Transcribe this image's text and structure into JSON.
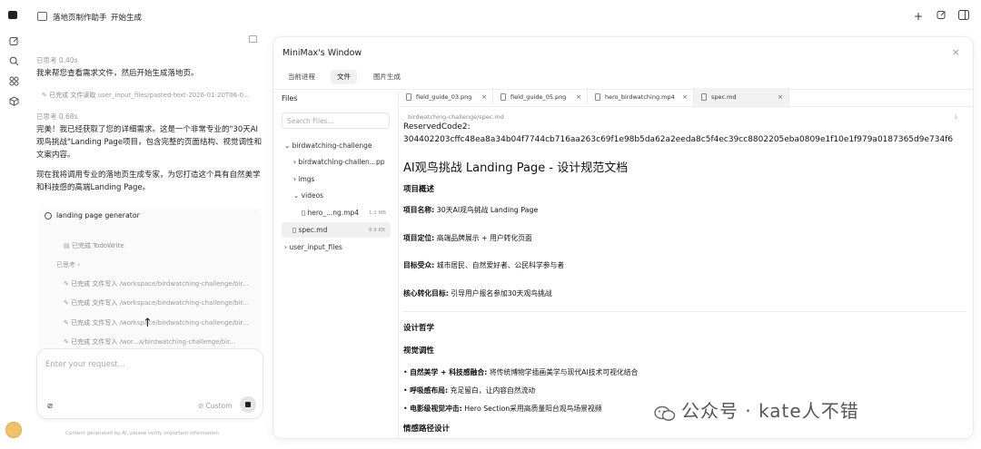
{
  "app": {
    "title": "落地页制作助手",
    "subtitle": "开始生成"
  },
  "rail": {
    "icons": [
      "logo-icon",
      "edit-icon",
      "search-icon",
      "grid-icon",
      "box-icon"
    ]
  },
  "chat": {
    "thought1": "已思考 0.40s",
    "msg1": "我来帮您查看需求文件，然后开始生成落地页。",
    "tool1_status": "已完成",
    "tool1_action": "文件读取",
    "tool1_path": "user_input_files/pasted-text-2026-01-20T06-0...",
    "thought2": "已思考 0.68s",
    "msg2": "完美！我已经获取了您的详细需求。这是一个非常专业的\"30天AI观鸟挑战\"Landing Page项目，包含完整的页面结构、视觉调性和文案内容。",
    "msg3": "现在我将调用专业的落地页生成专家，为您打造这个具有自然美学和科技感的高端Landing Page。",
    "generator_label": "landing page generator",
    "todo_status": "已完成",
    "todo_label": "TodoWrite",
    "thought3": "已思考",
    "file_writes": [
      {
        "status": "已完成",
        "action": "文件写入",
        "path": "/workspace/birdwatching-challenge/bir..."
      },
      {
        "status": "已完成",
        "action": "文件写入",
        "path": "/workspace/birdwatching-challenge/bir..."
      },
      {
        "status": "已完成",
        "action": "文件写入",
        "path": "/workspace/birdwatching-challenge/bir..."
      },
      {
        "status": "已完成",
        "action": "文件写入",
        "path": "/wor...a/birdwatching-challenge/bir..."
      },
      {
        "status": "已完成",
        "action": "文件写入",
        "path": "/workspace/birdwatching-challenge/bir..."
      }
    ],
    "input_placeholder": "Enter your request...",
    "custom_label": "Custom",
    "footer": "Content generated by AI, please verify important information"
  },
  "window": {
    "title": "MiniMax's Window",
    "tabs": [
      "当前进程",
      "文件",
      "图片生成"
    ],
    "active_tab": 1,
    "files_title": "Files",
    "search_placeholder": "Search Files...",
    "tree": {
      "root": "birdwatching-challenge",
      "child1": "birdwatching-challen...pp",
      "imgs": "imgs",
      "videos": "videos",
      "video_file": "hero_...ng.mp4",
      "video_size": "1.1 MB",
      "spec": "spec.md",
      "spec_size": "8.9 KB",
      "user_input": "user_input_files"
    },
    "file_tabs": [
      {
        "label": "field_guide_03.png",
        "icon": "image-file-icon"
      },
      {
        "label": "field_guide_05.png",
        "icon": "image-file-icon"
      },
      {
        "label": "hero_birdwatching.mp4",
        "icon": "video-file-icon"
      },
      {
        "label": "spec.md",
        "icon": "doc-file-icon"
      }
    ],
    "active_file_tab": 3,
    "breadcrumb": "birdwatching-challenge/spec.md"
  },
  "doc": {
    "code_label": "ReservedCode2:",
    "code_value": "304402203cffc48ea8a34b04f7744cb716aa263c69f1e98b5da62a2eeda8c5f4ec39cc8802205eba0809e1f10e1f979a0187365d9e734f6",
    "h1": "AI观鸟挑战 Landing Page - 设计规范文档",
    "sec1": "项目概述",
    "name_label": "项目名称:",
    "name_value": "30天AI观鸟挑战 Landing Page",
    "pos_label": "项目定位:",
    "pos_value": "高端品牌展示 + 用户转化页面",
    "aud_label": "目标受众:",
    "aud_value": "城市居民、自然爱好者、公民科学参与者",
    "goal_label": "核心转化目标:",
    "goal_value": "引导用户报名参加30天观鸟挑战",
    "sec2": "设计哲学",
    "sec3": "视觉调性",
    "b1_label": "自然美学 + 科技感融合:",
    "b1_value": "将传统博物学插画美学与现代AI技术可视化结合",
    "b2_label": "呼吸感布局:",
    "b2_value": "充足留白，让内容自然流动",
    "b3_label": "电影级视觉冲击:",
    "b3_value": "Hero Section采用高质量阳台观鸟场景视频",
    "sec4": "情感路径设计"
  },
  "watermark": "公众号 · kate人不错"
}
